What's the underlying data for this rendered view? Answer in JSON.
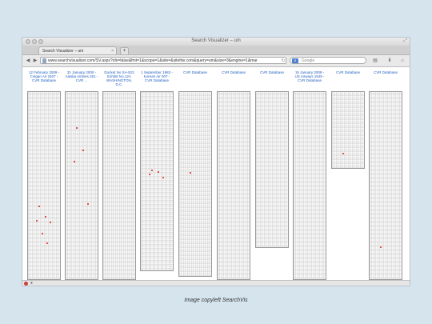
{
  "window": {
    "title": "Search Visualizer – um",
    "resize_icon": "resize-arrows-icon"
  },
  "tab": {
    "label": "Search Visualizer – um",
    "close": "×",
    "new_tab": "+"
  },
  "toolbar": {
    "url": "www.searchvisualizer.com/SV.aspx?ohi=false&fmt=1&scope=1&site=&sitehte.com&query=um&size=3&engine=1&mar",
    "search_placeholder": "Google",
    "search_engine_icon": "google-icon",
    "search_engine_letter": "8"
  },
  "columns": [
    {
      "title": "12 February 2009 - Colgan Air 3407 - CVR Database",
      "dots": [
        0.61,
        0.67,
        0.69,
        0.7,
        0.76,
        0.81
      ]
    },
    {
      "title": "31 January 2000 - Alaska Airlines 261 - CVR ...",
      "dots": [
        0.19,
        0.31,
        0.37,
        0.6
      ]
    },
    {
      "title": "Docket No SA-523 Exhibit No.12A WASHINGTON, D.C.",
      "dots": []
    },
    {
      "title": "1 September 1983 - Korean Air 007 - CVR Database",
      "dots": [
        0.44,
        0.45,
        0.46,
        0.48
      ]
    },
    {
      "title": "CVR Database",
      "dots": [
        0.44
      ]
    },
    {
      "title": "CVR Database",
      "dots": []
    },
    {
      "title": "CVR Database",
      "dots": []
    },
    {
      "title": "15 January 2009 - US Airways 1549 - CVR Database",
      "dots": []
    },
    {
      "title": "CVR Database",
      "dots": [
        0.82
      ]
    },
    {
      "title": "CVR Database",
      "dots": [
        0.83
      ]
    }
  ],
  "status": {
    "text": "●"
  },
  "caption": "Image copyleft SearchVis"
}
